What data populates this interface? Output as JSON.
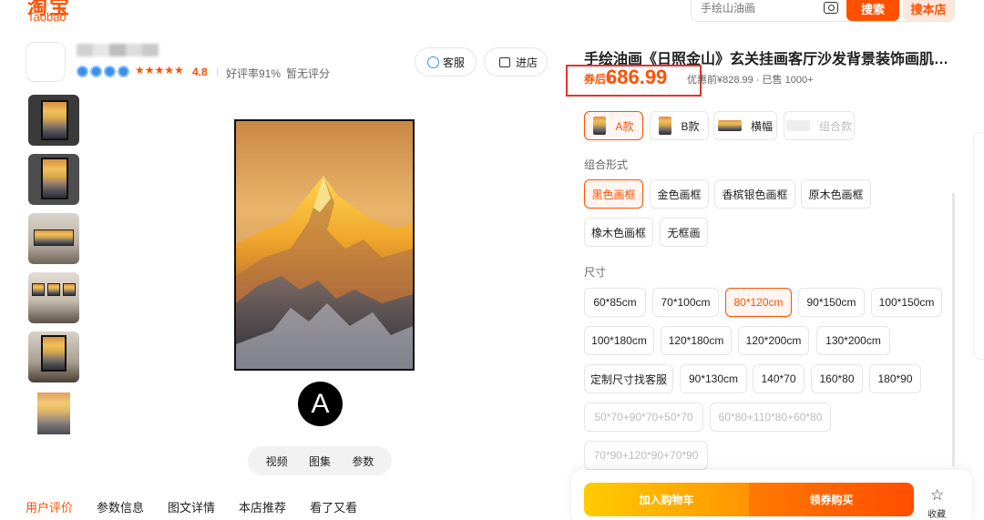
{
  "logo": {
    "cn": "淘宝",
    "en": "Taobao"
  },
  "search": {
    "placeholder": "手绘山油画",
    "search_label": "搜索",
    "shop_label": "搜本店"
  },
  "shop": {
    "rating": "4.8",
    "good_rate": "好评率91%",
    "no_rating": "暂无评分",
    "service_label": "客服",
    "enter_label": "进店"
  },
  "media_tabs": [
    "视频",
    "图集",
    "参数"
  ],
  "main_badge": "A",
  "bottom_tabs": [
    "用户评价",
    "参数信息",
    "图文详情",
    "本店推荐",
    "看了又看"
  ],
  "product": {
    "title": "手绘油画《日照金山》玄关挂画客厅沙发背景装饰画肌…",
    "price_prefix": "券后¥",
    "price": "686.99",
    "original": "优惠前¥828.99 · 已售 1000+"
  },
  "styles": [
    {
      "label": "A款",
      "selected": true,
      "disabled": false
    },
    {
      "label": "B款",
      "selected": false,
      "disabled": false
    },
    {
      "label": "横幅",
      "selected": false,
      "disabled": false
    },
    {
      "label": "组合款",
      "selected": false,
      "disabled": true
    }
  ],
  "combo": {
    "label": "组合形式",
    "options": [
      "黑色画框",
      "金色画框",
      "香槟银色画框",
      "原木色画框",
      "橡木色画框",
      "无框画"
    ]
  },
  "size": {
    "label": "尺寸",
    "options": [
      "60*85cm",
      "70*100cm",
      "80*120cm",
      "90*150cm",
      "100*150cm",
      "100*180cm",
      "120*180cm",
      "120*200cm",
      "130*200cm",
      "定制尺寸找客服",
      "90*130cm",
      "140*70",
      "160*80",
      "180*90",
      "50*70+90*70+50*70",
      "60*80+110*80+60*80",
      "70*90+120*90+70*90"
    ]
  },
  "buybar": {
    "cart_label": "加入购物车",
    "buy_label": "领券购买",
    "fav_label": "收藏"
  },
  "colors": {
    "accent": "#ff5000",
    "highlight_box": "#e5322e"
  }
}
